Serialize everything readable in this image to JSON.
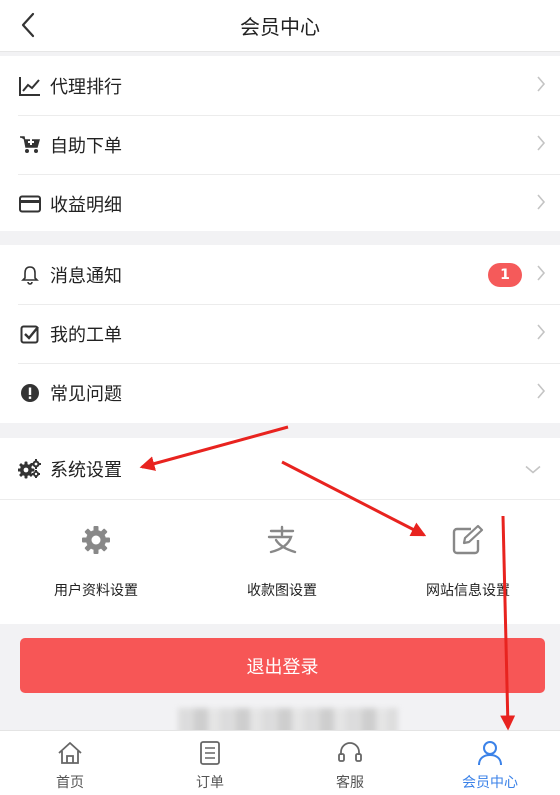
{
  "header": {
    "title": "会员中心",
    "back_icon": "chevron-left-icon"
  },
  "menu_group_1": [
    {
      "label": "代理排行",
      "icon": "trend-chart-icon"
    },
    {
      "label": "自助下单",
      "icon": "cart-icon"
    },
    {
      "label": "收益明细",
      "icon": "card-icon"
    }
  ],
  "menu_group_2": [
    {
      "label": "消息通知",
      "icon": "bell-icon",
      "badge": "1"
    },
    {
      "label": "我的工单",
      "icon": "checkbox-icon"
    },
    {
      "label": "常见问题",
      "icon": "exclamation-icon"
    }
  ],
  "settings": {
    "label": "系统设置",
    "icon": "gears-icon",
    "expanded": true,
    "items": [
      {
        "label": "用户资料设置",
        "icon": "gear-icon"
      },
      {
        "label": "收款图设置",
        "icon": "alipay-icon"
      },
      {
        "label": "网站信息设置",
        "icon": "edit-icon"
      }
    ]
  },
  "logout_label": "退出登录",
  "tabbar": [
    {
      "label": "首页",
      "icon": "home-icon",
      "active": false
    },
    {
      "label": "订单",
      "icon": "document-icon",
      "active": false
    },
    {
      "label": "客服",
      "icon": "headset-icon",
      "active": false
    },
    {
      "label": "会员中心",
      "icon": "user-icon",
      "active": true
    }
  ],
  "colors": {
    "accent_blue": "#3b82e8",
    "logout_red": "#f75656",
    "badge_red": "#f55a5a",
    "annotation_arrow": "#e8231f"
  }
}
